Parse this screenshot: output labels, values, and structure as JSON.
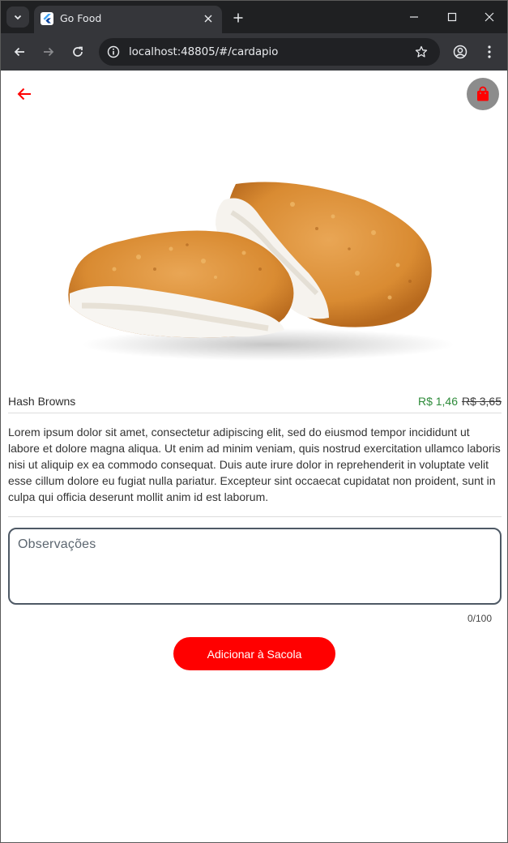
{
  "browser": {
    "tab_title": "Go Food",
    "url": "localhost:48805/#/cardapio"
  },
  "product": {
    "name": "Hash Browns",
    "price": "R$ 1,46",
    "old_price": "R$ 3,65",
    "description": "Lorem ipsum dolor sit amet, consectetur adipiscing elit, sed do eiusmod tempor incididunt ut labore et dolore magna aliqua. Ut enim ad minim veniam, quis nostrud exercitation ullamco laboris nisi ut aliquip ex ea commodo consequat. Duis aute irure dolor in reprehenderit in voluptate velit esse cillum dolore eu fugiat nulla pariatur. Excepteur sint occaecat cupidatat non proident, sunt in culpa qui officia deserunt mollit anim id est laborum."
  },
  "notes": {
    "placeholder": "Observações",
    "value": "",
    "counter": "0/100"
  },
  "actions": {
    "add_to_bag_label": "Adicionar à Sacola"
  },
  "colors": {
    "accent": "#ff0000",
    "price_green": "#2e8b3a",
    "bag_button_bg": "#8c8c8c"
  },
  "icons": {
    "back": "arrow-left-icon",
    "bag": "shopping-bag-icon"
  }
}
